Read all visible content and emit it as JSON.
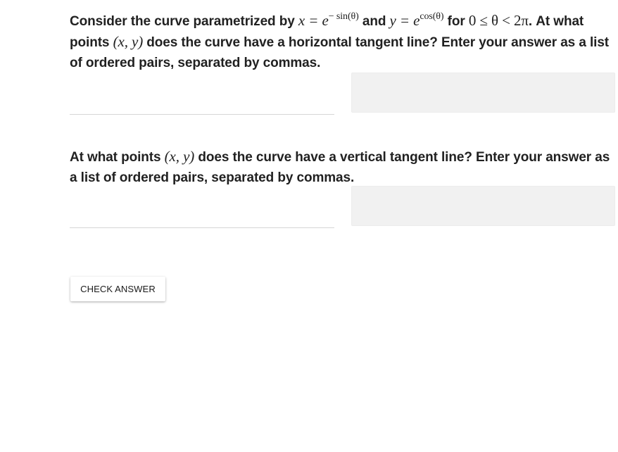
{
  "question1": {
    "text_before": "Consider the curve parametrized by ",
    "math_x": "x = e",
    "math_x_exponent": "− sin(θ)",
    "text_and": " and ",
    "math_y": "y = e",
    "math_y_exponent": "cos(θ)",
    "text_for": " for ",
    "math_range": "0 ≤ θ < 2π",
    "text_after": ". At what points ",
    "math_point": "(x, y)",
    "text_end": " does the curve have a horizontal tangent line? Enter your answer as a list of ordered pairs, separated by commas."
  },
  "answer1": {
    "value": ""
  },
  "question2": {
    "text_before": "At what points ",
    "math_point": "(x, y)",
    "text_end": " does the curve have a vertical tangent line? Enter your answer as a list of ordered pairs, separated by commas."
  },
  "answer2": {
    "value": ""
  },
  "check_button": {
    "label": "CHECK ANSWER"
  }
}
